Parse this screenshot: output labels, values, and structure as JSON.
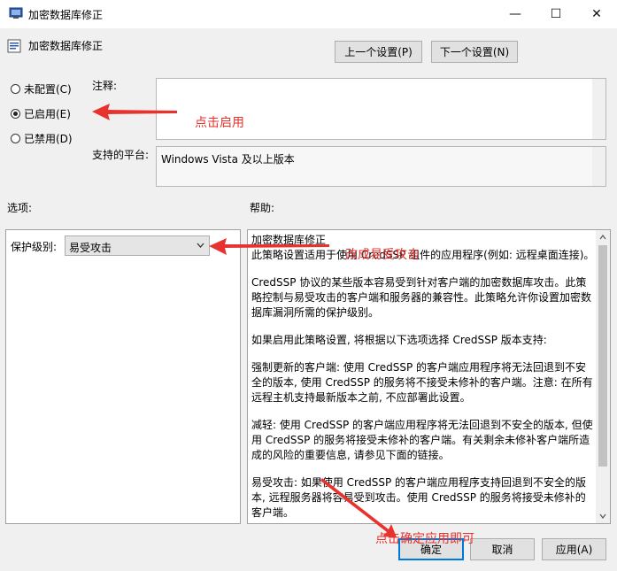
{
  "window": {
    "title": "加密数据库修正",
    "min": "—",
    "max": "☐",
    "close": "✕"
  },
  "header": {
    "policy_name": "加密数据库修正",
    "prev_label": "上一个设置(P)",
    "next_label": "下一个设置(N)"
  },
  "state": {
    "not_configured": "未配置(C)",
    "enabled": "已启用(E)",
    "disabled": "已禁用(D)",
    "selected": "enabled"
  },
  "comment_label": "注释:",
  "platform_label": "支持的平台:",
  "platform_value": "Windows Vista 及以上版本",
  "options_label": "选项:",
  "help_label": "帮助:",
  "protection": {
    "label": "保护级别:",
    "value": "易受攻击"
  },
  "help_text": [
    "加密数据库修正",
    "此策略设置适用于使用 CredSSP 组件的应用程序(例如: 远程桌面连接)。",
    "CredSSP 协议的某些版本容易受到针对客户端的加密数据库攻击。此策略控制与易受攻击的客户端和服务器的兼容性。此策略允许你设置加密数据库漏洞所需的保护级别。",
    "如果启用此策略设置, 将根据以下选项选择 CredSSP 版本支持:",
    "强制更新的客户端: 使用 CredSSP 的客户端应用程序将无法回退到不安全的版本, 使用 CredSSP 的服务将不接受未修补的客户端。注意: 在所有远程主机支持最新版本之前, 不应部署此设置。",
    "减轻: 使用 CredSSP 的客户端应用程序将无法回退到不安全的版本, 但使用 CredSSP 的服务将接受未修补的客户端。有关剩余未修补客户端所造成的风险的重要信息, 请参见下面的链接。",
    "易受攻击: 如果使用 CredSSP 的客户端应用程序支持回退到不安全的版本, 远程服务器将容易受到攻击。使用 CredSSP 的服务将接受未修补的客户端。"
  ],
  "footer": {
    "ok": "确定",
    "cancel": "取消",
    "apply": "应用(A)"
  },
  "annotations": {
    "enable": "点击启用",
    "vuln": "改成易受攻击",
    "ok": "点击确定应用即可"
  },
  "colors": {
    "accent": "#0078d7",
    "annotation": "#e8322d"
  }
}
